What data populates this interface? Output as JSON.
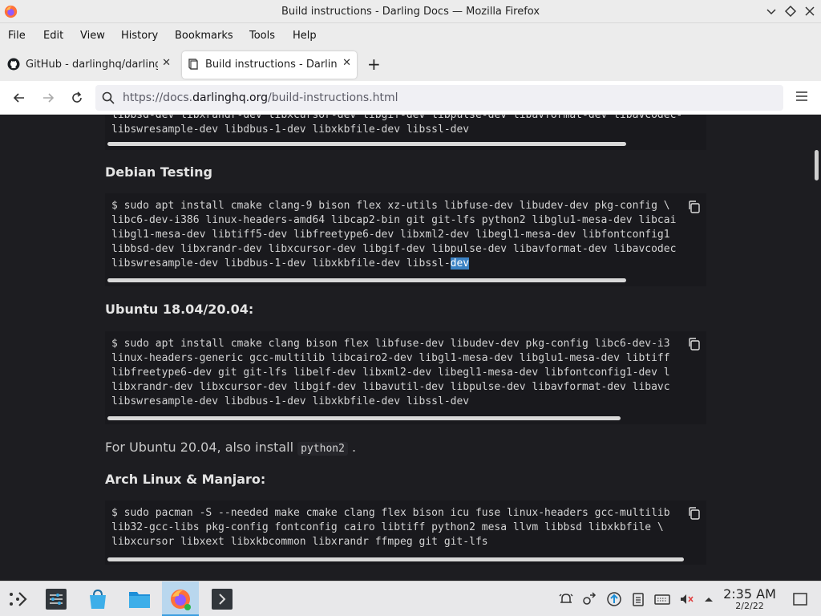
{
  "window": {
    "title": "Build instructions - Darling Docs — Mozilla Firefox"
  },
  "menu": [
    "File",
    "Edit",
    "View",
    "History",
    "Bookmarks",
    "Tools",
    "Help"
  ],
  "tabs": [
    {
      "label": "GitHub - darlinghq/darling",
      "active": false
    },
    {
      "label": "Build instructions - Darling",
      "active": true
    }
  ],
  "url": {
    "prefix": "https://docs.",
    "domain": "darlinghq.org",
    "path": "/build-instructions.html"
  },
  "content": {
    "block0": {
      "lines": [
        "libbsd-dev libxrandr-dev libxcursor-dev libgif-dev libpulse-dev libavformat-dev libavcodec-",
        "libswresample-dev libdbus-1-dev libxkbfile-dev libssl-dev"
      ]
    },
    "debian": {
      "heading": "Debian Testing",
      "lines": [
        "$ sudo apt install cmake clang-9 bison flex xz-utils libfuse-dev libudev-dev pkg-config \\",
        "libc6-dev-i386 linux-headers-amd64 libcap2-bin git git-lfs python2 libglu1-mesa-dev libcai",
        "libgl1-mesa-dev libtiff5-dev libfreetype6-dev libxml2-dev libegl1-mesa-dev libfontconfig1",
        "libbsd-dev libxrandr-dev libxcursor-dev libgif-dev libpulse-dev libavformat-dev libavcodec",
        "libswresample-dev libdbus-1-dev libxkbfile-dev libssl-"
      ],
      "selected": "dev"
    },
    "ubuntu": {
      "heading": "Ubuntu 18.04/20.04:",
      "lines": [
        "$ sudo apt install cmake clang bison flex libfuse-dev libudev-dev pkg-config libc6-dev-i3",
        "linux-headers-generic gcc-multilib libcairo2-dev libgl1-mesa-dev libglu1-mesa-dev libtiff",
        "libfreetype6-dev git git-lfs libelf-dev libxml2-dev libegl1-mesa-dev libfontconfig1-dev l",
        "libxrandr-dev libxcursor-dev libgif-dev libavutil-dev libpulse-dev libavformat-dev libavc",
        "libswresample-dev libdbus-1-dev libxkbfile-dev libssl-dev"
      ]
    },
    "ubuntu_note": {
      "before": "For Ubuntu 20.04, also install",
      "code": "python2",
      "after": "."
    },
    "arch": {
      "heading": "Arch Linux & Manjaro:",
      "lines": [
        "$ sudo pacman -S --needed make cmake clang flex bison icu fuse linux-headers gcc-multilib",
        "lib32-gcc-libs pkg-config fontconfig cairo libtiff python2 mesa llvm libbsd libxkbfile \\",
        "libxcursor libxext libxkbcommon libxrandr ffmpeg git git-lfs"
      ]
    }
  },
  "taskbar": {
    "time": "2:35 AM",
    "date": "2/2/22"
  },
  "colors": {
    "page_bg": "#1d1d21",
    "code_bg": "#19191d",
    "selection": "#3b82c4",
    "active_task": "#b9d7ee"
  }
}
